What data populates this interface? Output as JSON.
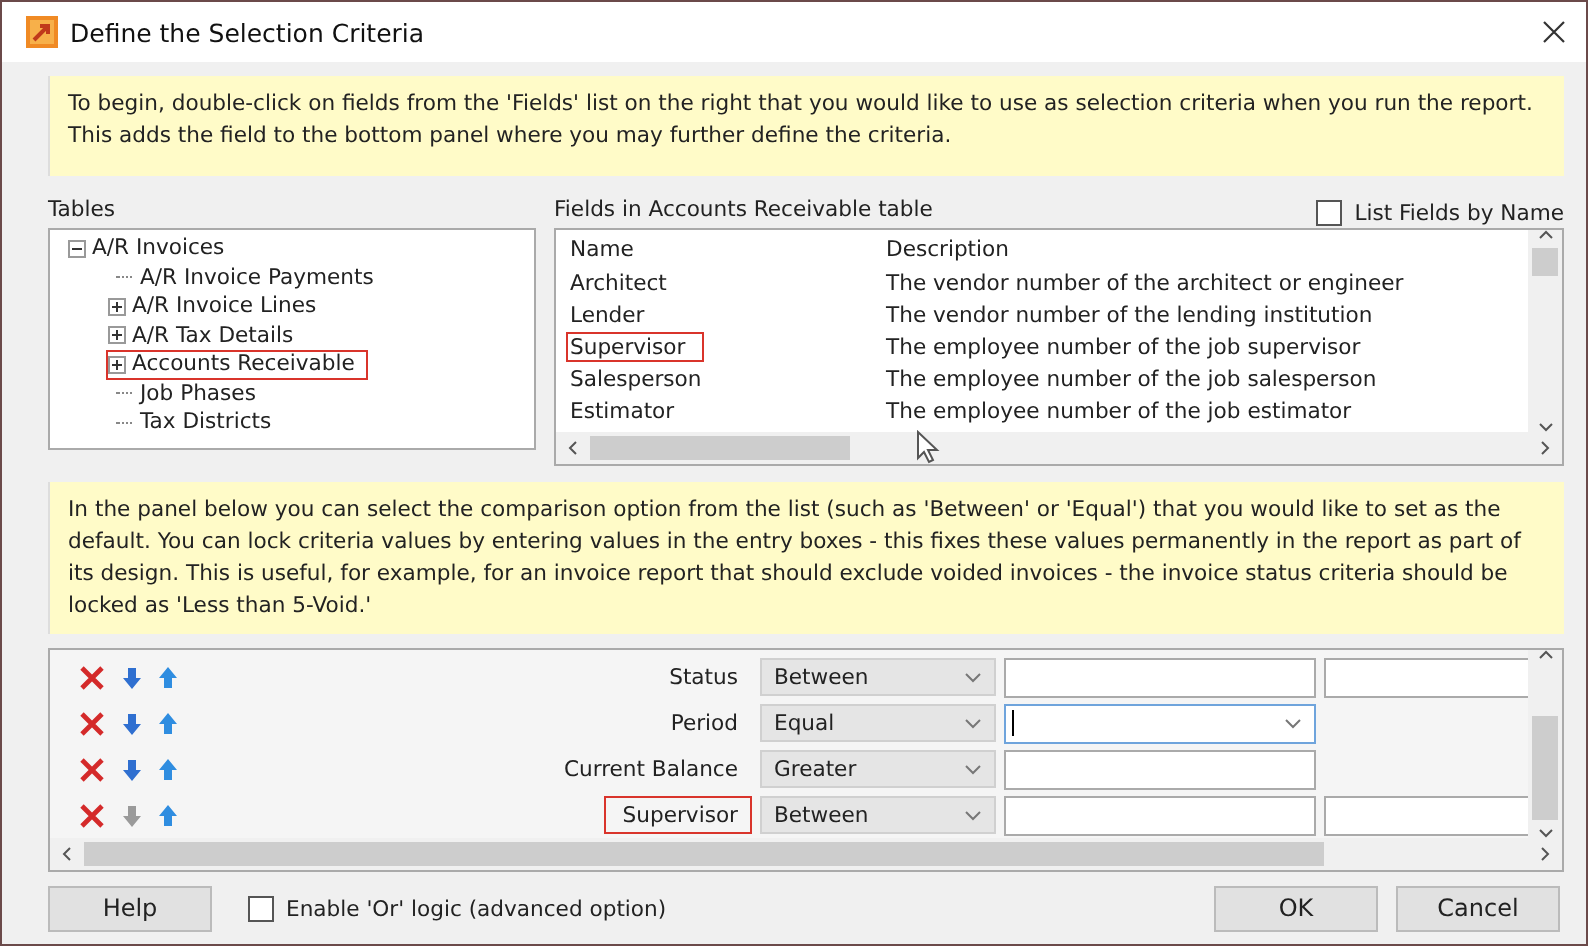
{
  "window": {
    "title": "Define the Selection Criteria"
  },
  "intro_note": "To begin, double-click on fields from the 'Fields' list on the right that you would like to use as selection criteria when you run the report. This adds the field to the bottom panel where you may further define the criteria.",
  "tables": {
    "label": "Tables",
    "tree": [
      {
        "label": "A/R Invoices",
        "kind": "group",
        "expanded": true,
        "highlighted": false,
        "children": [
          {
            "label": "A/R Invoice Payments",
            "kind": "leaf",
            "highlighted": false
          },
          {
            "label": "A/R Invoice Lines",
            "kind": "group",
            "expanded": false,
            "highlighted": false
          },
          {
            "label": "A/R Tax Details",
            "kind": "group",
            "expanded": false,
            "highlighted": false
          },
          {
            "label": "Accounts Receivable",
            "kind": "group",
            "expanded": false,
            "highlighted": true
          },
          {
            "label": "Job Phases",
            "kind": "leaf",
            "highlighted": false
          },
          {
            "label": "Tax Districts",
            "kind": "leaf",
            "highlighted": false
          }
        ]
      }
    ]
  },
  "fields": {
    "label": "Fields in Accounts Receivable table",
    "list_by_name": {
      "label": "List Fields by Name",
      "checked": false
    },
    "columns": [
      "Name",
      "Description"
    ],
    "rows": [
      {
        "name": "Architect",
        "description": "The vendor number of the architect or engineer",
        "highlighted": false
      },
      {
        "name": "Lender",
        "description": "The vendor number of the lending institution",
        "highlighted": false
      },
      {
        "name": "Supervisor",
        "description": "The employee number of the job supervisor",
        "highlighted": true
      },
      {
        "name": "Salesperson",
        "description": "The employee number of the job salesperson",
        "highlighted": false
      },
      {
        "name": "Estimator",
        "description": "The employee number of the job estimator",
        "highlighted": false
      }
    ]
  },
  "criteria_note": "In the panel below you can select the comparison option from the list (such as 'Between' or 'Equal') that you would like to set as the default. You can lock criteria values by entering values in the entry boxes - this fixes these values permanently in the report as part of its design. This is useful, for example, for an invoice report that should exclude voided invoices - the invoice status criteria should be locked as 'Less than 5-Void.'",
  "criteria": [
    {
      "field": "Status",
      "comparison": "Between",
      "kind": "range",
      "highlighted": false,
      "down_enabled": true
    },
    {
      "field": "Period",
      "comparison": "Equal",
      "kind": "dropdown",
      "highlighted": false,
      "down_enabled": true
    },
    {
      "field": "Current Balance",
      "comparison": "Greater",
      "kind": "single",
      "highlighted": false,
      "down_enabled": true
    },
    {
      "field": "Supervisor",
      "comparison": "Between",
      "kind": "range",
      "highlighted": true,
      "down_enabled": false
    }
  ],
  "footer": {
    "help": "Help",
    "or_logic": {
      "label": "Enable 'Or' logic (advanced option)",
      "checked": false
    },
    "ok": "OK",
    "cancel": "Cancel"
  }
}
